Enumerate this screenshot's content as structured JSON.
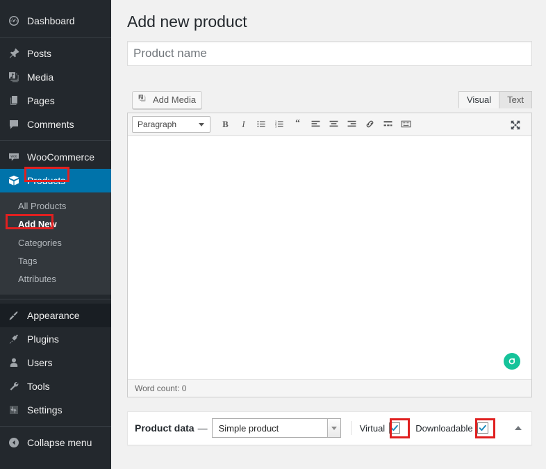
{
  "sidebar": {
    "items": [
      {
        "label": "Dashboard",
        "icon": "dashboard-icon",
        "state": "normal"
      },
      {
        "label": "Posts",
        "icon": "pin-icon",
        "state": "normal"
      },
      {
        "label": "Media",
        "icon": "media-icon",
        "state": "normal"
      },
      {
        "label": "Pages",
        "icon": "pages-icon",
        "state": "normal"
      },
      {
        "label": "Comments",
        "icon": "comments-icon",
        "state": "normal"
      },
      {
        "label": "WooCommerce",
        "icon": "woocommerce-icon",
        "state": "normal"
      },
      {
        "label": "Products",
        "icon": "products-box-icon",
        "state": "current"
      },
      {
        "label": "Appearance",
        "icon": "appearance-brush-icon",
        "state": "hover"
      },
      {
        "label": "Plugins",
        "icon": "plugins-plug-icon",
        "state": "normal"
      },
      {
        "label": "Users",
        "icon": "users-icon",
        "state": "normal"
      },
      {
        "label": "Tools",
        "icon": "tools-wrench-icon",
        "state": "normal"
      },
      {
        "label": "Settings",
        "icon": "settings-sliders-icon",
        "state": "normal"
      },
      {
        "label": "Collapse menu",
        "icon": "collapse-arrow-icon",
        "state": "normal"
      }
    ],
    "products_submenu": [
      {
        "label": "All Products",
        "current": false
      },
      {
        "label": "Add New",
        "current": true
      },
      {
        "label": "Categories",
        "current": false
      },
      {
        "label": "Tags",
        "current": false
      },
      {
        "label": "Attributes",
        "current": false
      }
    ],
    "highlight_color": "#e02020",
    "current_color": "#0073aa"
  },
  "main": {
    "page_title": "Add new product",
    "title_field": {
      "value": "",
      "placeholder": "Product name"
    },
    "editor": {
      "add_media_label": "Add Media",
      "tabs": [
        {
          "label": "Visual",
          "active": true
        },
        {
          "label": "Text",
          "active": false
        }
      ],
      "format_select": {
        "value": "Paragraph"
      },
      "toolbar_buttons": [
        "bold-icon",
        "italic-icon",
        "bulleted-list-icon",
        "numbered-list-icon",
        "blockquote-icon",
        "align-left-icon",
        "align-center-icon",
        "align-right-icon",
        "insert-link-icon",
        "read-more-icon",
        "toolbar-toggle-icon"
      ],
      "fullscreen_icon": "distraction-free-icon",
      "content": "",
      "grammarly_badge": "G",
      "grammarly_color": "#15c39a",
      "word_count_label": "Word count: 0"
    },
    "product_data": {
      "title": "Product data",
      "dash": "—",
      "type_value": "Simple product",
      "virtual": {
        "label": "Virtual",
        "checked": true,
        "highlighted": true
      },
      "downloadable": {
        "label": "Downloadable",
        "checked": true,
        "highlighted": true
      },
      "toggle_icon": "collapse-panel-icon"
    }
  }
}
